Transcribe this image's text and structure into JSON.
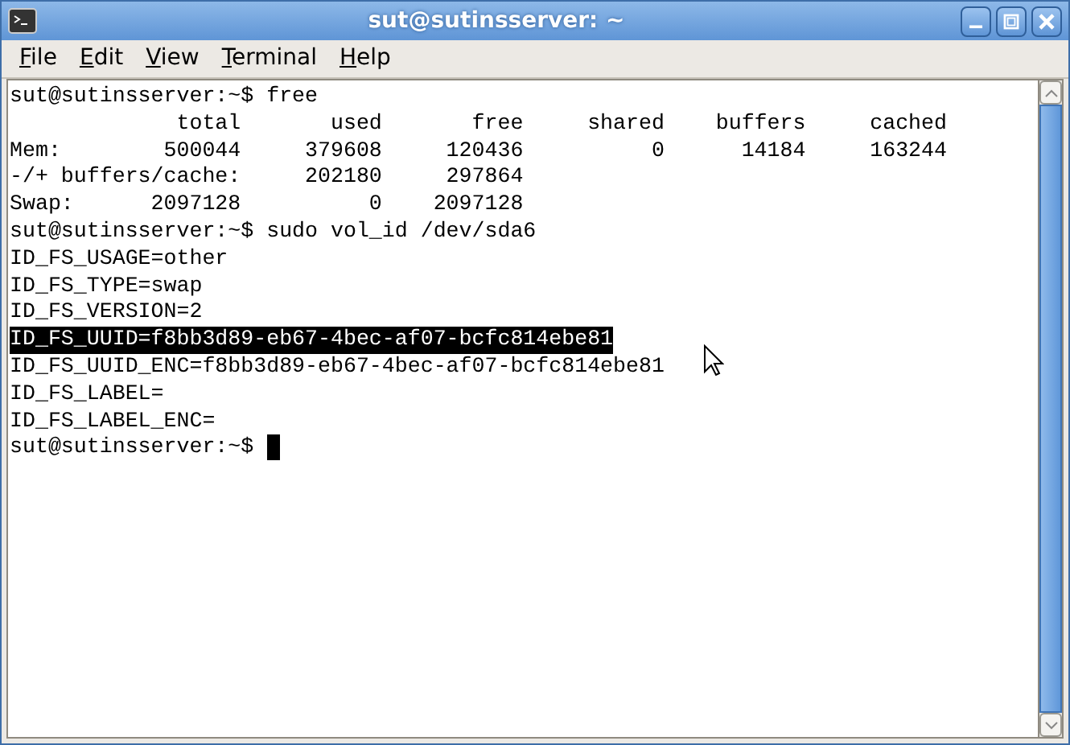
{
  "window": {
    "title": "sut@sutinsserver: ~"
  },
  "menu": [
    "File",
    "Edit",
    "View",
    "Terminal",
    "Help"
  ],
  "terminal": {
    "lines": [
      {
        "text": "sut@sutinsserver:~$ free",
        "selected": false
      },
      {
        "text": "             total       used       free     shared    buffers     cached",
        "selected": false
      },
      {
        "text": "Mem:        500044     379608     120436          0      14184     163244",
        "selected": false
      },
      {
        "text": "-/+ buffers/cache:     202180     297864",
        "selected": false
      },
      {
        "text": "Swap:      2097128          0    2097128",
        "selected": false
      },
      {
        "text": "sut@sutinsserver:~$ sudo vol_id /dev/sda6",
        "selected": false
      },
      {
        "text": "ID_FS_USAGE=other",
        "selected": false
      },
      {
        "text": "ID_FS_TYPE=swap",
        "selected": false
      },
      {
        "text": "ID_FS_VERSION=2",
        "selected": false
      },
      {
        "text": "ID_FS_UUID=f8bb3d89-eb67-4bec-af07-bcfc814ebe81",
        "selected": true
      },
      {
        "text": "ID_FS_UUID_ENC=f8bb3d89-eb67-4bec-af07-bcfc814ebe81",
        "selected": false
      },
      {
        "text": "ID_FS_LABEL=",
        "selected": false
      },
      {
        "text": "ID_FS_LABEL_ENC=",
        "selected": false
      },
      {
        "text": "sut@sutinsserver:~$",
        "selected": false
      }
    ],
    "cursor": true
  }
}
